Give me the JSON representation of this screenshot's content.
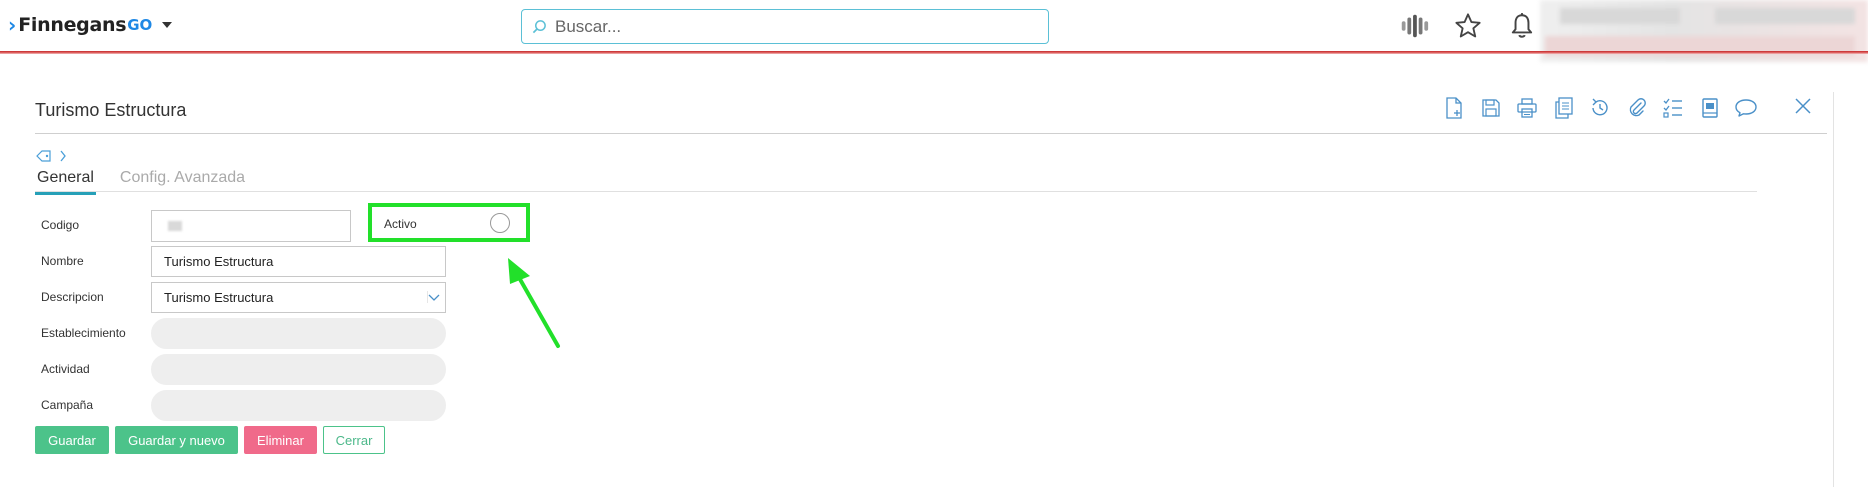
{
  "app": {
    "logo_text": "Finnegans",
    "logo_go": "GO"
  },
  "search": {
    "placeholder": "Buscar..."
  },
  "header_icons": [
    "voice-icon",
    "star-icon",
    "bell-icon"
  ],
  "panel": {
    "title": "Turismo Estructura",
    "toolbar": [
      "new-document-icon",
      "save-icon",
      "print-icon",
      "copy-icon",
      "history-icon",
      "attach-icon",
      "checklist-icon",
      "book-icon",
      "comment-icon"
    ],
    "close_icon": "close-icon"
  },
  "tabs": [
    {
      "label": "General",
      "active": true
    },
    {
      "label": "Config. Avanzada",
      "active": false
    }
  ],
  "form": {
    "codigo_label": "Codigo",
    "nombre_label": "Nombre",
    "nombre_value": "Turismo Estructura",
    "descripcion_label": "Descripcion",
    "descripcion_value": "Turismo Estructura",
    "establecimiento_label": "Establecimiento",
    "actividad_label": "Actividad",
    "campana_label": "Campaña",
    "activo_label": "Activo",
    "activo_on": false
  },
  "buttons": {
    "guardar": "Guardar",
    "guardar_nuevo": "Guardar y nuevo",
    "eliminar": "Eliminar",
    "cerrar": "Cerrar"
  },
  "colors": {
    "accent": "#1e88e5",
    "tab_underline": "#26a0b8",
    "button_green": "#4cc38a",
    "button_red": "#f06a8a",
    "highlight": "#22e02a",
    "topbar_line": "#c62828"
  }
}
